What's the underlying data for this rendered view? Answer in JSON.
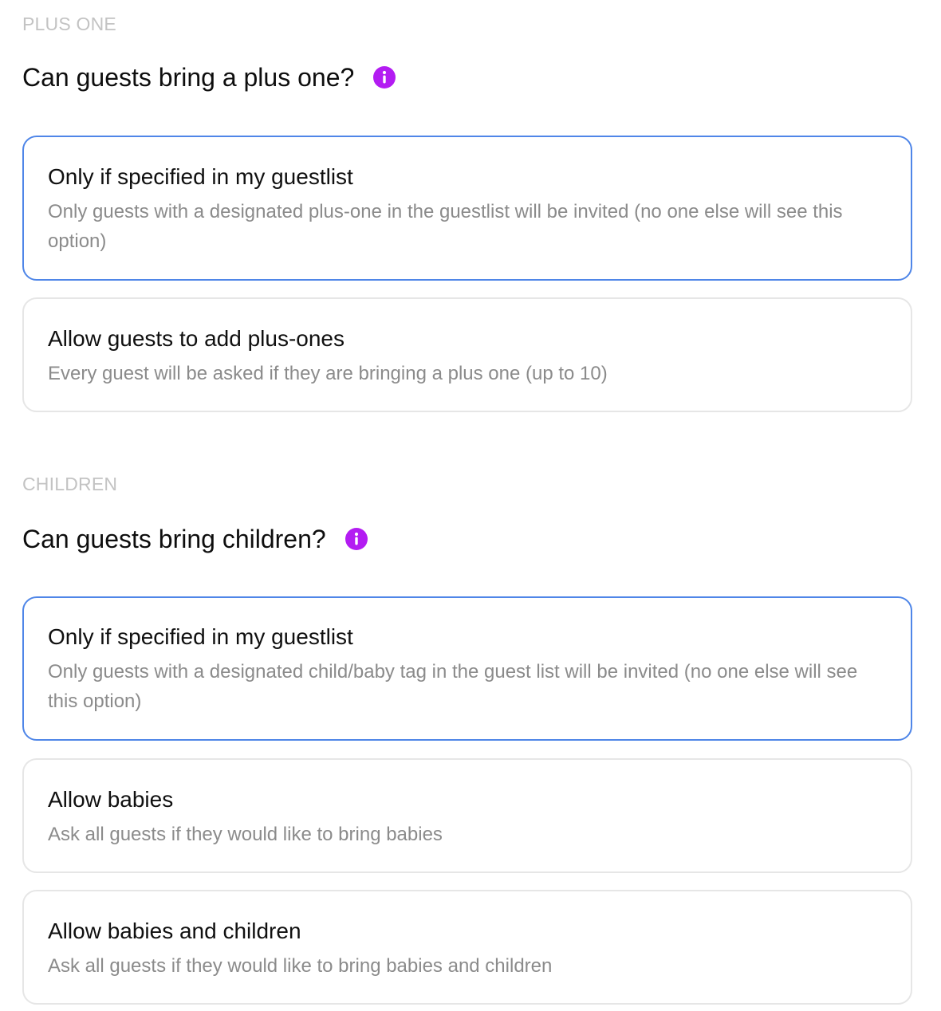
{
  "plus_one": {
    "section_label": "PLUS ONE",
    "question": "Can guests bring a plus one?",
    "info_icon": "info-icon",
    "options": [
      {
        "title": "Only if specified in my guestlist",
        "description": "Only guests with a designated plus-one in the guestlist will be invited (no one else will see this option)",
        "selected": true
      },
      {
        "title": "Allow guests to add plus-ones",
        "description": "Every guest will be asked if they are bringing a plus one (up to 10)",
        "selected": false
      }
    ]
  },
  "children": {
    "section_label": "CHILDREN",
    "question": "Can guests bring children?",
    "info_icon": "info-icon",
    "options": [
      {
        "title": "Only if specified in my guestlist",
        "description": "Only guests with a designated child/baby tag in the guest list will be invited (no one else will see this option)",
        "selected": true
      },
      {
        "title": "Allow babies",
        "description": "Ask all guests if they would like to bring babies",
        "selected": false
      },
      {
        "title": "Allow babies and children",
        "description": "Ask all guests if they would like to bring babies and children",
        "selected": false
      }
    ]
  },
  "colors": {
    "accent_selected_border": "#4f86e8",
    "info_icon": "#b31cf2",
    "section_label": "#c3c3c3",
    "description_text": "#8b8b8b"
  }
}
